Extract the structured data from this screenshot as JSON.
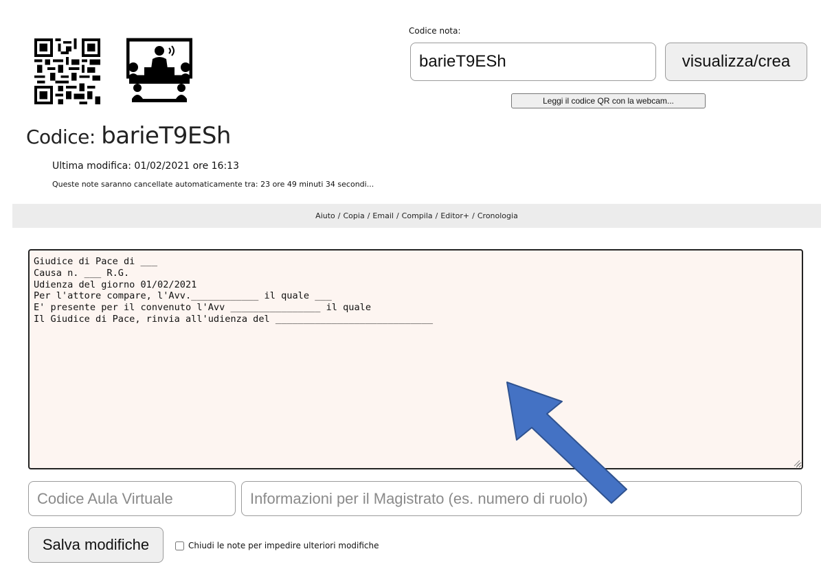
{
  "header": {
    "qr_icon": "qr-code-icon",
    "conference_icon": "videoconference-icon",
    "code_label": "Codice nota:",
    "code_value": "barieT9ESh",
    "view_button": "visualizza/crea",
    "webcam_button": "Leggi il codice QR con la webcam..."
  },
  "title": {
    "prefix": "Codice: ",
    "code": "barieT9ESh"
  },
  "info": {
    "last_modified": "Ultima modifica: 01/02/2021 ore 16:13",
    "auto_delete": "Queste note saranno cancellate automaticamente tra: 23 ore 49 minuti 34 secondi..."
  },
  "links": [
    "Aiuto",
    "Copia",
    "Email",
    "Compila",
    "Editor+",
    "Cronologia"
  ],
  "notes": {
    "content": "Giudice di Pace di ___\nCausa n. ___ R.G.\nUdienza del giorno 01/02/2021\nPer l'attore compare, l'Avv.____________ il quale ___\nE' presente per il convenuto l'Avv ________________ il quale\nIl Giudice di Pace, rinvia all'udienza del ____________________________"
  },
  "fields": {
    "aula_placeholder": "Codice Aula Virtuale",
    "magistrato_placeholder": "Informazioni per il Magistrato (es. numero di ruolo)"
  },
  "footer": {
    "save_button": "Salva modifiche",
    "lock_label": "Chiudi le note per impedire ulteriori modifiche",
    "lock_checked": false
  },
  "annotation": {
    "arrow_color": "#4472c4"
  }
}
